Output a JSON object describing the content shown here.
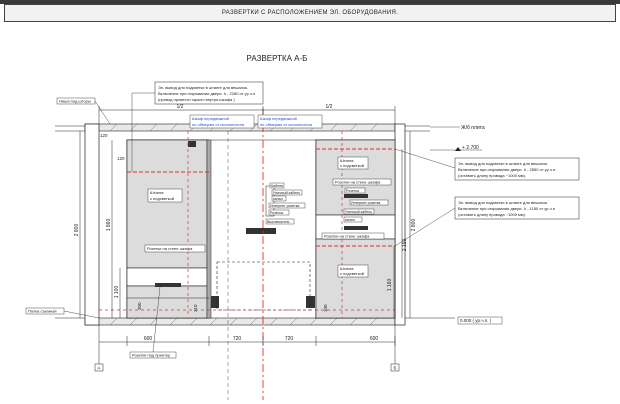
{
  "header": {
    "title": "РАЗВЕРТКИ С РАСПОЛОЖЕНИЕМ ЭЛ. ОБОРУДОВАНИЯ."
  },
  "sheet": {
    "title": "РАЗВЕРТКА А-Б"
  },
  "colors": {
    "line": "#222222",
    "red": "#e0302a",
    "blue": "#2a4fd6",
    "fill": "#d9d9d9",
    "dark": "#333333"
  },
  "notes": {
    "top": [
      "Эл. вывод для подсветки в штанге для вешалок.",
      "Включение при открывании двери. h - 2280 от ур.ч.п",
      "(провод провести скрыто внутри шкафа )"
    ],
    "right1": [
      "Эл. вывод для подсветки в штанге для вешалок.",
      "Включение при открывании двери. h - 2850 от ур.ч.п",
      "(оставить длину провода ~1000 мм)."
    ],
    "right2": [
      "Эл. вывод для подсветки в штанге для вешалок.",
      "Включение при открывании двери. h - 1180 от ур.ч.п",
      "(оставить длину провода ~1000 мм)."
    ]
  },
  "labels": {
    "ceiling_niche": "Ниша под шторы",
    "floor_slab": "Ж/б плита",
    "level_top": "+ 2.700",
    "level_zero": "0.000 ( ур.ч.п. )",
    "removable_floor": "Полка съемная",
    "printer_socket": "Розетки под принтер",
    "wardrobe_left": [
      "Шкаф передвижной",
      "по обмерам от исполнителя"
    ],
    "wardrobe_right": [
      "Шкаф передвижной",
      "по обмерам от исполнителя"
    ],
    "rod_left": [
      "Штанга",
      "с подсветкой"
    ],
    "rod_right_top": [
      "Штанга",
      "с подсветкой"
    ],
    "rod_right_bottom": [
      "Штанга",
      "с подсветкой"
    ],
    "wardrobe_socket_left": "Розетки на стене шкафа",
    "wardrobe_socket_right_top": "Розетки на стене шкафа",
    "wardrobe_socket_right_mid": "Розетки на стене шкафа",
    "socket": "Розетка",
    "socket_small": "Розетки",
    "switch_label": "Выкл.",
    "cable_group": [
      "Кабели",
      "Уличный кабель",
      "канал",
      "Интернет розетка",
      "Розетка",
      "Выключатель"
    ],
    "right_group": [
      "Розетка",
      "Интернет розетка",
      "Уличный кабель",
      "канал"
    ]
  },
  "dimensions": {
    "top_half_left": "1/2",
    "top_half_right": "1/2",
    "bottom": [
      "600",
      "720",
      "720",
      "600"
    ],
    "left_verticals": [
      "2 800",
      "1 860",
      "1 100"
    ],
    "right_verticals": [
      "2 800",
      "2 150",
      "1 160"
    ],
    "marks": [
      "120",
      "120",
      "310",
      "300",
      "100"
    ]
  },
  "axis_bubbles": [
    "А",
    "Б"
  ]
}
